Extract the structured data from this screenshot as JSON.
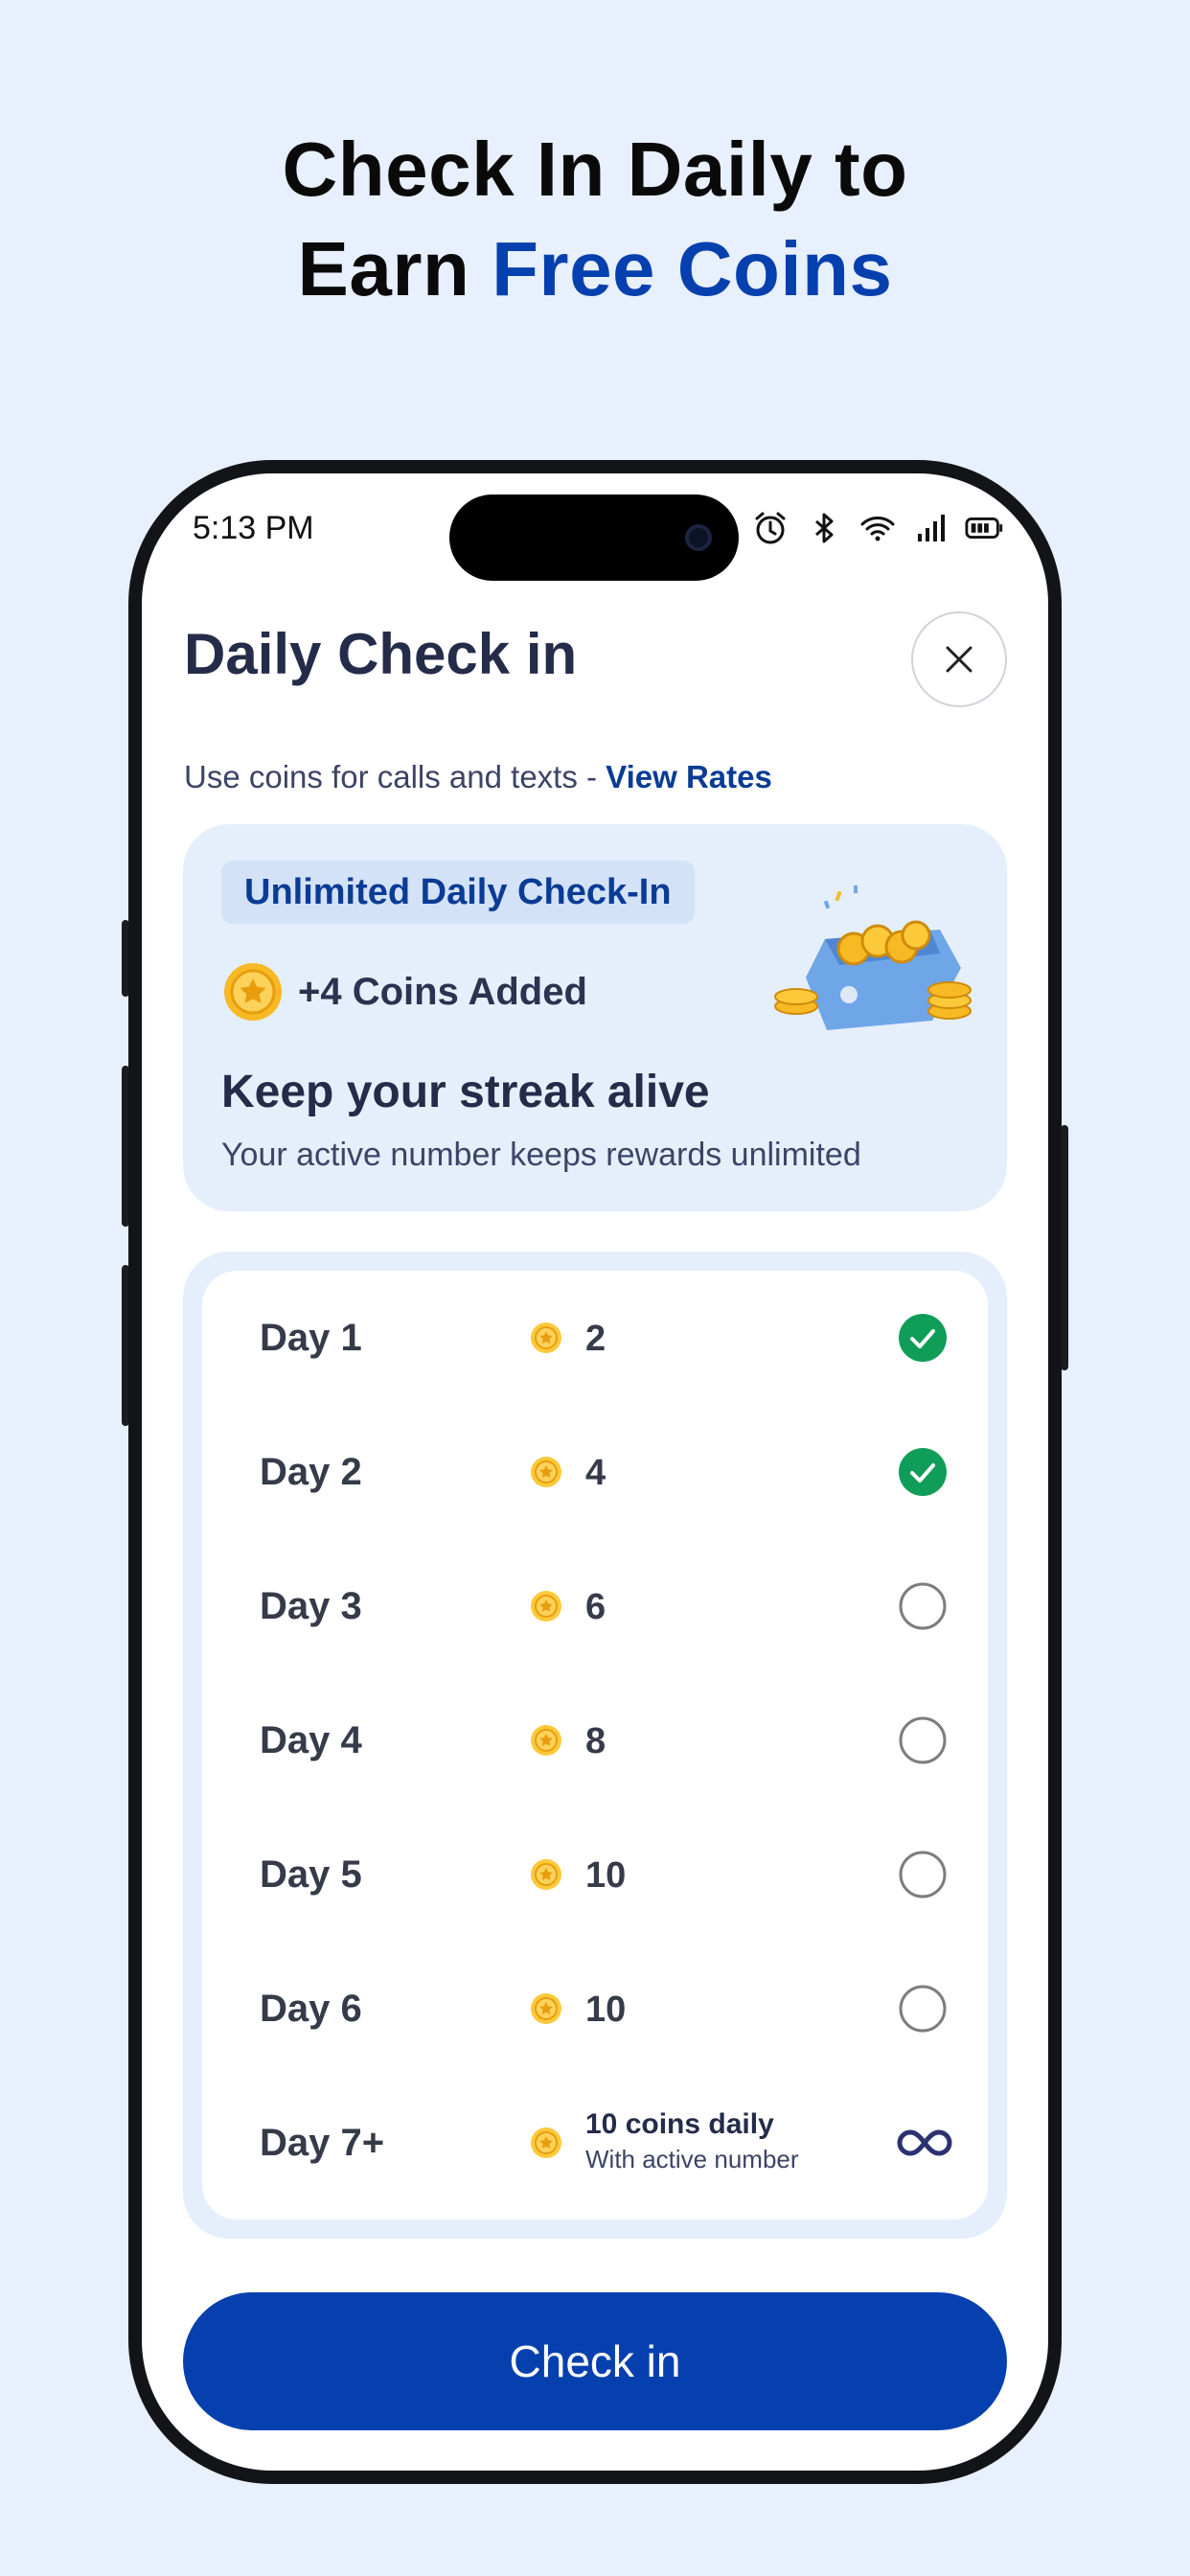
{
  "headline": {
    "line1": "Check In Daily to",
    "line2_plain": "Earn ",
    "line2_accent": "Free Coins"
  },
  "status_bar": {
    "time": "5:13 PM",
    "icons": [
      "alarm-icon",
      "bluetooth-icon",
      "wifi-icon",
      "cellular-signal-icon",
      "battery-icon"
    ]
  },
  "sheet": {
    "title": "Daily Check in",
    "close_icon": "close-icon",
    "subtitle_text": "Use coins for calls and texts - ",
    "subtitle_link": "View Rates"
  },
  "promo": {
    "badge": "Unlimited Daily Check-In",
    "coins_added": "+4 Coins Added",
    "heading": "Keep your streak alive",
    "description": "Your active number keeps rewards unlimited",
    "art_icon": "coin-box-illustration"
  },
  "days": [
    {
      "label": "Day 1",
      "coins": "2",
      "status": "done"
    },
    {
      "label": "Day 2",
      "coins": "4",
      "status": "done"
    },
    {
      "label": "Day 3",
      "coins": "6",
      "status": "pending"
    },
    {
      "label": "Day 4",
      "coins": "8",
      "status": "pending"
    },
    {
      "label": "Day 5",
      "coins": "10",
      "status": "pending"
    },
    {
      "label": "Day 6",
      "coins": "10",
      "status": "pending"
    }
  ],
  "day7": {
    "label": "Day 7+",
    "coins_main": "10 coins daily",
    "coins_sub": "With active number",
    "status_icon": "infinity-icon"
  },
  "cta": {
    "label": "Check in"
  },
  "colors": {
    "brand": "#0640ae",
    "check_green": "#0f9d58",
    "coin_gold": "#f7b924",
    "background": "#e8f0fd"
  }
}
